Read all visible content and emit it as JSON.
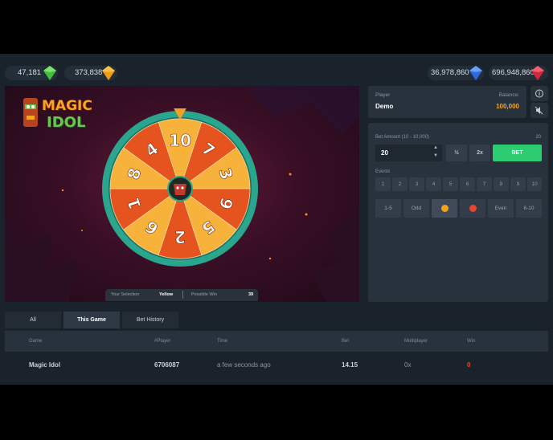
{
  "topbar": {
    "green_gems": "47,181",
    "orange_gems": "373,838",
    "blue_gems": "36,978,860",
    "red_gems": "696,948,860"
  },
  "game": {
    "logo_top": "MAGIC",
    "logo_bottom": "IDOL",
    "wheel_numbers": [
      "10",
      "7",
      "3",
      "9",
      "5",
      "2",
      "6",
      "1",
      "8",
      "4"
    ],
    "wheel_colors": [
      "#f6b23a",
      "#e5531e"
    ],
    "selection_label": "Your Selection",
    "selection_value": "Yellow",
    "possible_win_label": "Possible Win",
    "possible_win_value": "39"
  },
  "player": {
    "player_label": "Player",
    "player_name": "Demo",
    "balance_label": "Balance:",
    "balance_value": "100,000"
  },
  "bet": {
    "amount_label": "Bet Amount (10 - 10,000)",
    "amount_max": "20",
    "amount_value": "20",
    "half_label": "½",
    "double_label": "2x",
    "bet_label": "BET",
    "events_label": "Events",
    "events": [
      "1",
      "2",
      "3",
      "4",
      "5",
      "6",
      "7",
      "8",
      "9",
      "10"
    ],
    "options": [
      "1-5",
      "Odd",
      "",
      "",
      "Even",
      "6-10"
    ],
    "option_colors": [
      "#f6a219",
      "#e8452e"
    ]
  },
  "tabs": [
    "All",
    "This Game",
    "Bet History"
  ],
  "table": {
    "headers": [
      "Game",
      "#Player",
      "Time",
      "Bet",
      "Multiplayer",
      "Win"
    ],
    "row": [
      "Magic Idol",
      "6706087",
      "a few seconds ago",
      "14.15",
      "0x",
      "0"
    ]
  }
}
